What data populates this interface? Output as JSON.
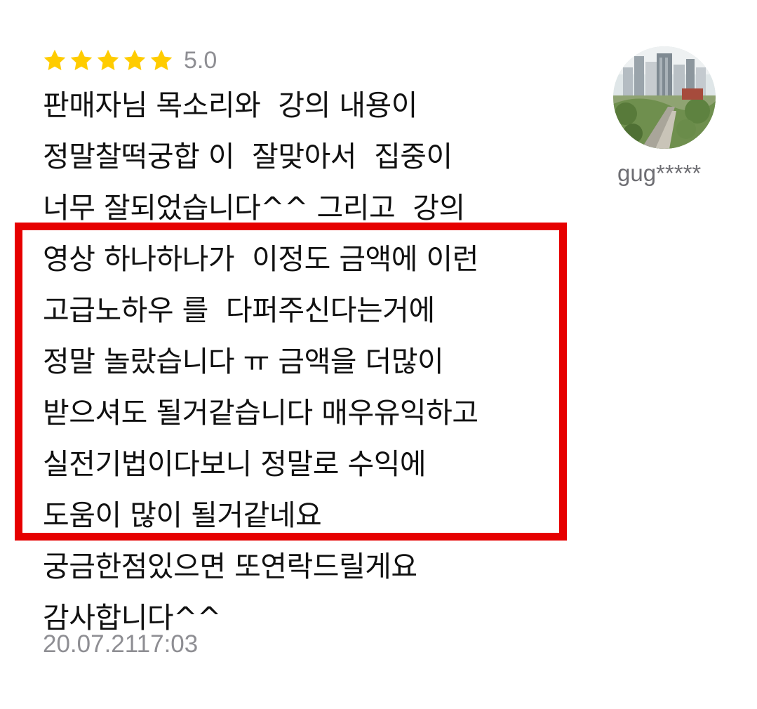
{
  "review": {
    "rating": 5,
    "rating_label": "5.0",
    "star_count": 5,
    "star_color": "#FFCC00",
    "body_lines": [
      "판매자님 목소리와  강의 내용이",
      "정말찰떡궁합 이  잘맞아서  집중이",
      "너무 잘되었습니다^^ 그리고  강의",
      "영상 하나하나가  이정도 금액에 이런",
      "고급노하우 를  다퍼주신다는거에",
      "정말 놀랐습니다 ㅠ 금액을 더많이",
      "받으셔도 될거같습니다 매우유익하고",
      "실전기법이다보니 정말로 수익에",
      "도움이 많이 될거같네요",
      "궁금한점있으면 또연락드릴게요",
      "감사합니다^^"
    ],
    "timestamp": "20.07.2117:03"
  },
  "reviewer": {
    "username": "gug*****"
  },
  "highlight": {
    "color": "#E60000"
  }
}
